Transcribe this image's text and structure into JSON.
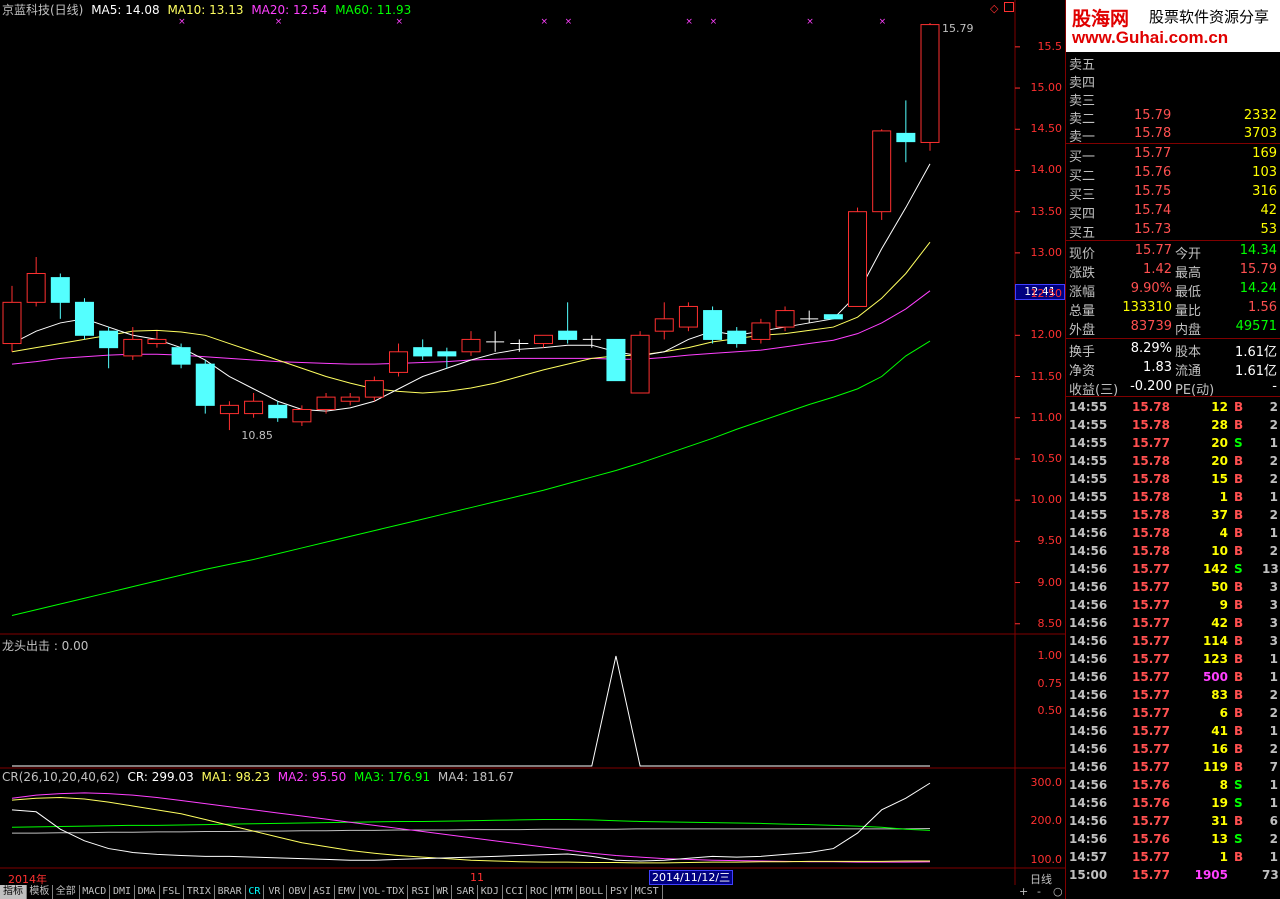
{
  "main_title": {
    "name": "京蓝科技(日线)",
    "ma5": "MA5: 14.08",
    "ma10": "MA10: 13.13",
    "ma20": "MA20: 12.54",
    "ma60": "MA60: 11.93"
  },
  "colors": {
    "up": "#ff3030",
    "down": "#54ffff",
    "ma5": "#ffffff",
    "ma10": "#ffff60",
    "ma20": "#ff40ff",
    "ma60": "#00ff00",
    "axis": "#ff3030",
    "grid": "#800000"
  },
  "price_axis": [
    "15.5",
    "15.00",
    "14.50",
    "14.00",
    "13.50",
    "13.00",
    "12.50",
    "12.00",
    "11.50",
    "11.00",
    "10.50",
    "10.00",
    "9.50",
    "9.00",
    "8.50"
  ],
  "price_axis_values": [
    15.5,
    15.0,
    14.5,
    14.0,
    13.5,
    13.0,
    12.5,
    12.0,
    11.5,
    11.0,
    10.5,
    10.0,
    9.5,
    9.0,
    8.5
  ],
  "current_price_label": "12.41",
  "high_marker": "15.79",
  "low_marker": "10.85",
  "candles": [
    {
      "o": 11.9,
      "c": 12.4,
      "h": 12.6,
      "l": 11.8
    },
    {
      "o": 12.4,
      "c": 12.75,
      "h": 12.95,
      "l": 12.35
    },
    {
      "o": 12.7,
      "c": 12.4,
      "h": 12.75,
      "l": 12.2
    },
    {
      "o": 12.4,
      "c": 12.0,
      "h": 12.45,
      "l": 11.95
    },
    {
      "o": 12.05,
      "c": 11.85,
      "h": 12.1,
      "l": 11.6
    },
    {
      "o": 11.75,
      "c": 11.95,
      "h": 12.1,
      "l": 11.7
    },
    {
      "o": 11.9,
      "c": 11.95,
      "h": 12.05,
      "l": 11.85
    },
    {
      "o": 11.85,
      "c": 11.65,
      "h": 11.9,
      "l": 11.6
    },
    {
      "o": 11.65,
      "c": 11.15,
      "h": 11.7,
      "l": 11.05
    },
    {
      "o": 11.05,
      "c": 11.15,
      "h": 11.2,
      "l": 10.85
    },
    {
      "o": 11.05,
      "c": 11.2,
      "h": 11.3,
      "l": 11.0
    },
    {
      "o": 11.15,
      "c": 11.0,
      "h": 11.2,
      "l": 10.95
    },
    {
      "o": 10.95,
      "c": 11.1,
      "h": 11.15,
      "l": 10.9
    },
    {
      "o": 11.1,
      "c": 11.25,
      "h": 11.3,
      "l": 11.05
    },
    {
      "o": 11.2,
      "c": 11.25,
      "h": 11.3,
      "l": 11.15
    },
    {
      "o": 11.25,
      "c": 11.45,
      "h": 11.5,
      "l": 11.2
    },
    {
      "o": 11.55,
      "c": 11.8,
      "h": 11.9,
      "l": 11.5
    },
    {
      "o": 11.85,
      "c": 11.75,
      "h": 11.95,
      "l": 11.7
    },
    {
      "o": 11.8,
      "c": 11.75,
      "h": 11.85,
      "l": 11.6
    },
    {
      "o": 11.8,
      "c": 11.95,
      "h": 12.05,
      "l": 11.75
    },
    {
      "o": 11.9,
      "c": 11.92,
      "h": 12.05,
      "l": 11.8
    },
    {
      "o": 11.9,
      "c": 11.88,
      "h": 11.95,
      "l": 11.8
    },
    {
      "o": 11.9,
      "c": 12.0,
      "h": 12.0,
      "l": 11.85
    },
    {
      "o": 12.05,
      "c": 11.95,
      "h": 12.4,
      "l": 11.9
    },
    {
      "o": 11.95,
      "c": 11.95,
      "h": 12.0,
      "l": 11.85
    },
    {
      "o": 11.95,
      "c": 11.45,
      "h": 11.95,
      "l": 11.45
    },
    {
      "o": 11.3,
      "c": 12.0,
      "h": 12.05,
      "l": 11.3
    },
    {
      "o": 12.05,
      "c": 12.2,
      "h": 12.4,
      "l": 11.95
    },
    {
      "o": 12.1,
      "c": 12.35,
      "h": 12.4,
      "l": 12.05
    },
    {
      "o": 12.3,
      "c": 11.95,
      "h": 12.35,
      "l": 11.9
    },
    {
      "o": 12.05,
      "c": 11.9,
      "h": 12.1,
      "l": 11.85
    },
    {
      "o": 11.95,
      "c": 12.15,
      "h": 12.2,
      "l": 11.9
    },
    {
      "o": 12.1,
      "c": 12.3,
      "h": 12.35,
      "l": 12.05
    },
    {
      "o": 12.2,
      "c": 12.2,
      "h": 12.3,
      "l": 12.15
    },
    {
      "o": 12.25,
      "c": 12.2,
      "h": 12.25,
      "l": 12.2
    },
    {
      "o": 12.35,
      "c": 13.5,
      "h": 13.55,
      "l": 12.35
    },
    {
      "o": 13.5,
      "c": 14.48,
      "h": 14.5,
      "l": 13.4
    },
    {
      "o": 14.45,
      "c": 14.35,
      "h": 14.85,
      "l": 14.1
    },
    {
      "o": 14.34,
      "c": 15.77,
      "h": 15.79,
      "l": 14.24
    }
  ],
  "ma5": [
    11.9,
    12.05,
    12.15,
    12.2,
    12.1,
    12.0,
    11.95,
    11.85,
    11.7,
    11.5,
    11.35,
    11.2,
    11.1,
    11.08,
    11.12,
    11.2,
    11.35,
    11.5,
    11.6,
    11.7,
    11.78,
    11.83,
    11.85,
    11.88,
    11.88,
    11.8,
    11.75,
    11.8,
    11.95,
    12.05,
    12.0,
    12.05,
    12.1,
    12.15,
    12.2,
    12.5,
    13.05,
    13.55,
    14.08
  ],
  "ma10": [
    11.8,
    11.85,
    11.9,
    11.95,
    12.0,
    12.05,
    12.06,
    12.04,
    12.0,
    11.9,
    11.8,
    11.7,
    11.6,
    11.5,
    11.42,
    11.35,
    11.32,
    11.3,
    11.32,
    11.36,
    11.42,
    11.5,
    11.58,
    11.65,
    11.72,
    11.75,
    11.76,
    11.8,
    11.85,
    11.92,
    11.96,
    12.0,
    12.02,
    12.06,
    12.1,
    12.22,
    12.45,
    12.75,
    13.13
  ],
  "ma20": [
    11.65,
    11.68,
    11.72,
    11.74,
    11.76,
    11.77,
    11.77,
    11.76,
    11.74,
    11.72,
    11.7,
    11.68,
    11.67,
    11.66,
    11.65,
    11.65,
    11.66,
    11.67,
    11.68,
    11.7,
    11.71,
    11.72,
    11.72,
    11.72,
    11.72,
    11.71,
    11.71,
    11.73,
    11.76,
    11.78,
    11.8,
    11.82,
    11.86,
    11.9,
    11.94,
    12.02,
    12.15,
    12.32,
    12.54
  ],
  "ma60": [
    8.6,
    8.67,
    8.74,
    8.81,
    8.88,
    8.95,
    9.02,
    9.09,
    9.16,
    9.22,
    9.28,
    9.35,
    9.42,
    9.49,
    9.56,
    9.63,
    9.7,
    9.77,
    9.84,
    9.91,
    9.98,
    10.05,
    10.12,
    10.2,
    10.28,
    10.36,
    10.45,
    10.55,
    10.65,
    10.75,
    10.86,
    10.96,
    11.06,
    11.16,
    11.25,
    11.35,
    11.5,
    11.75,
    11.93
  ],
  "x_markers": [
    7,
    11,
    16,
    22,
    23,
    28,
    29,
    33,
    36
  ],
  "indicator1": {
    "title": "龙头出击 : 0.00",
    "axis": [
      "1.00",
      "0.75",
      "0.50"
    ],
    "axis_values": [
      1.0,
      0.75,
      0.5
    ],
    "values": [
      0,
      0,
      0,
      0,
      0,
      0,
      0,
      0,
      0,
      0,
      0,
      0,
      0,
      0,
      0,
      0,
      0,
      0,
      0,
      0,
      0,
      0,
      0,
      0,
      0,
      1,
      0,
      0,
      0,
      0,
      0,
      0,
      0,
      0,
      0,
      0,
      0,
      0,
      0
    ]
  },
  "indicator2": {
    "title": "CR(26,10,20,40,62)",
    "cr": "CR: 299.03",
    "ma1": "MA1: 98.23",
    "ma2": "MA2: 95.50",
    "ma3": "MA3: 176.91",
    "ma4": "MA4: 181.67",
    "axis": [
      "300.0",
      "200.0",
      "100.0"
    ],
    "axis_values": [
      300,
      200,
      100
    ],
    "cr_values": [
      230,
      225,
      180,
      150,
      130,
      120,
      115,
      112,
      110,
      110,
      108,
      106,
      104,
      102,
      100,
      100,
      102,
      104,
      106,
      108,
      110,
      112,
      114,
      116,
      110,
      100,
      98,
      100,
      105,
      110,
      108,
      110,
      115,
      120,
      130,
      170,
      230,
      260,
      299
    ],
    "ma1_values": [
      255,
      260,
      262,
      258,
      250,
      240,
      230,
      220,
      205,
      190,
      175,
      160,
      145,
      135,
      125,
      118,
      112,
      108,
      104,
      100,
      98,
      96,
      95,
      95,
      94,
      94,
      93,
      93,
      94,
      95,
      95,
      96,
      96,
      97,
      97,
      97,
      97,
      98,
      98
    ],
    "ma2_values": [
      260,
      268,
      272,
      274,
      272,
      268,
      262,
      254,
      246,
      238,
      230,
      222,
      214,
      206,
      198,
      190,
      182,
      174,
      166,
      158,
      150,
      142,
      134,
      126,
      118,
      112,
      108,
      104,
      102,
      100,
      99,
      98,
      97,
      96,
      96,
      95,
      95,
      95,
      95.5
    ],
    "ma3_values": [
      185,
      186,
      187,
      188,
      189,
      190,
      190,
      191,
      192,
      193,
      194,
      195,
      196,
      197,
      198,
      199,
      200,
      200,
      201,
      202,
      203,
      204,
      205,
      205,
      204,
      202,
      200,
      199,
      198,
      197,
      196,
      195,
      193,
      192,
      190,
      188,
      185,
      180,
      176.9
    ],
    "ma4_values": [
      170,
      170,
      171,
      171,
      172,
      172,
      173,
      173,
      174,
      174,
      175,
      175,
      176,
      176,
      177,
      177,
      178,
      178,
      178,
      179,
      179,
      179,
      180,
      180,
      180,
      180,
      181,
      181,
      181,
      181,
      181,
      181,
      181,
      181,
      181,
      181,
      181,
      181,
      181.7
    ]
  },
  "time_axis": {
    "year": "2014年",
    "month": "11",
    "cursor": "2014/11/12/三",
    "period": "日线"
  },
  "tabs": [
    "指标",
    "模板",
    "全部",
    "MACD",
    "DMI",
    "DMA",
    "FSL",
    "TRIX",
    "BRAR",
    "CR",
    "VR",
    "OBV",
    "ASI",
    "EMV",
    "VOL-TDX",
    "RSI",
    "WR",
    "SAR",
    "KDJ",
    "CCI",
    "ROC",
    "MTM",
    "BOLL",
    "PSY",
    "MCST"
  ],
  "tab_ctrl": [
    "+",
    "-",
    "○"
  ],
  "logo": {
    "name": "股海网",
    "slogan": "股票软件资源分享",
    "url": "www.Guhai.com.cn"
  },
  "asks": [
    {
      "label": "卖五",
      "price": "",
      "vol": ""
    },
    {
      "label": "卖四",
      "price": "",
      "vol": ""
    },
    {
      "label": "卖三",
      "price": "",
      "vol": ""
    },
    {
      "label": "卖二",
      "price": "15.79",
      "vol": "2332"
    },
    {
      "label": "卖一",
      "price": "15.78",
      "vol": "3703"
    }
  ],
  "bids": [
    {
      "label": "买一",
      "price": "15.77",
      "vol": "169"
    },
    {
      "label": "买二",
      "price": "15.76",
      "vol": "103"
    },
    {
      "label": "买三",
      "price": "15.75",
      "vol": "316"
    },
    {
      "label": "买四",
      "price": "15.74",
      "vol": "42"
    },
    {
      "label": "买五",
      "price": "15.73",
      "vol": "53"
    }
  ],
  "quote": [
    {
      "l1": "现价",
      "v1": "15.77",
      "l2": "今开",
      "v2": "14.34",
      "c1": "#ff5050",
      "c2": "#00ff00"
    },
    {
      "l1": "涨跌",
      "v1": "1.42",
      "l2": "最高",
      "v2": "15.79",
      "c1": "#ff5050",
      "c2": "#ff5050"
    },
    {
      "l1": "涨幅",
      "v1": "9.90%",
      "l2": "最低",
      "v2": "14.24",
      "c1": "#ff5050",
      "c2": "#00ff00"
    },
    {
      "l1": "总量",
      "v1": "133310",
      "l2": "量比",
      "v2": "1.56",
      "c1": "#ffff00",
      "c2": "#ff5050"
    },
    {
      "l1": "外盘",
      "v1": "83739",
      "l2": "内盘",
      "v2": "49571",
      "c1": "#ff5050",
      "c2": "#00ff00"
    }
  ],
  "quote2": [
    {
      "l1": "换手",
      "v1": "8.29%",
      "l2": "股本",
      "v2": "1.61亿"
    },
    {
      "l1": "净资",
      "v1": "1.83",
      "l2": "流通",
      "v2": "1.61亿"
    },
    {
      "l1": "收益(三)",
      "v1": "-0.200",
      "l2": "PE(动)",
      "v2": "-"
    }
  ],
  "ticks": [
    {
      "t": "14:55",
      "p": "15.78",
      "v": "12",
      "bs": "B",
      "n": "2"
    },
    {
      "t": "14:55",
      "p": "15.78",
      "v": "28",
      "bs": "B",
      "n": "2"
    },
    {
      "t": "14:55",
      "p": "15.77",
      "v": "20",
      "bs": "S",
      "n": "1"
    },
    {
      "t": "14:55",
      "p": "15.78",
      "v": "20",
      "bs": "B",
      "n": "2"
    },
    {
      "t": "14:55",
      "p": "15.78",
      "v": "15",
      "bs": "B",
      "n": "2"
    },
    {
      "t": "14:55",
      "p": "15.78",
      "v": "1",
      "bs": "B",
      "n": "1"
    },
    {
      "t": "14:55",
      "p": "15.78",
      "v": "37",
      "bs": "B",
      "n": "2"
    },
    {
      "t": "14:56",
      "p": "15.78",
      "v": "4",
      "bs": "B",
      "n": "1"
    },
    {
      "t": "14:56",
      "p": "15.78",
      "v": "10",
      "bs": "B",
      "n": "2"
    },
    {
      "t": "14:56",
      "p": "15.77",
      "v": "142",
      "bs": "S",
      "n": "13"
    },
    {
      "t": "14:56",
      "p": "15.77",
      "v": "50",
      "bs": "B",
      "n": "3"
    },
    {
      "t": "14:56",
      "p": "15.77",
      "v": "9",
      "bs": "B",
      "n": "3"
    },
    {
      "t": "14:56",
      "p": "15.77",
      "v": "42",
      "bs": "B",
      "n": "3"
    },
    {
      "t": "14:56",
      "p": "15.77",
      "v": "114",
      "bs": "B",
      "n": "3"
    },
    {
      "t": "14:56",
      "p": "15.77",
      "v": "123",
      "bs": "B",
      "n": "1"
    },
    {
      "t": "14:56",
      "p": "15.77",
      "v": "500",
      "bs": "B",
      "n": "1"
    },
    {
      "t": "14:56",
      "p": "15.77",
      "v": "83",
      "bs": "B",
      "n": "2"
    },
    {
      "t": "14:56",
      "p": "15.77",
      "v": "6",
      "bs": "B",
      "n": "2"
    },
    {
      "t": "14:56",
      "p": "15.77",
      "v": "41",
      "bs": "B",
      "n": "1"
    },
    {
      "t": "14:56",
      "p": "15.77",
      "v": "16",
      "bs": "B",
      "n": "2"
    },
    {
      "t": "14:56",
      "p": "15.77",
      "v": "119",
      "bs": "B",
      "n": "7"
    },
    {
      "t": "14:56",
      "p": "15.76",
      "v": "8",
      "bs": "S",
      "n": "1"
    },
    {
      "t": "14:56",
      "p": "15.76",
      "v": "19",
      "bs": "S",
      "n": "1"
    },
    {
      "t": "14:56",
      "p": "15.77",
      "v": "31",
      "bs": "B",
      "n": "6"
    },
    {
      "t": "14:56",
      "p": "15.76",
      "v": "13",
      "bs": "S",
      "n": "2"
    },
    {
      "t": "14:57",
      "p": "15.77",
      "v": "1",
      "bs": "B",
      "n": "1"
    },
    {
      "t": "15:00",
      "p": "15.77",
      "v": "1905",
      "bs": "",
      "n": "73"
    }
  ]
}
